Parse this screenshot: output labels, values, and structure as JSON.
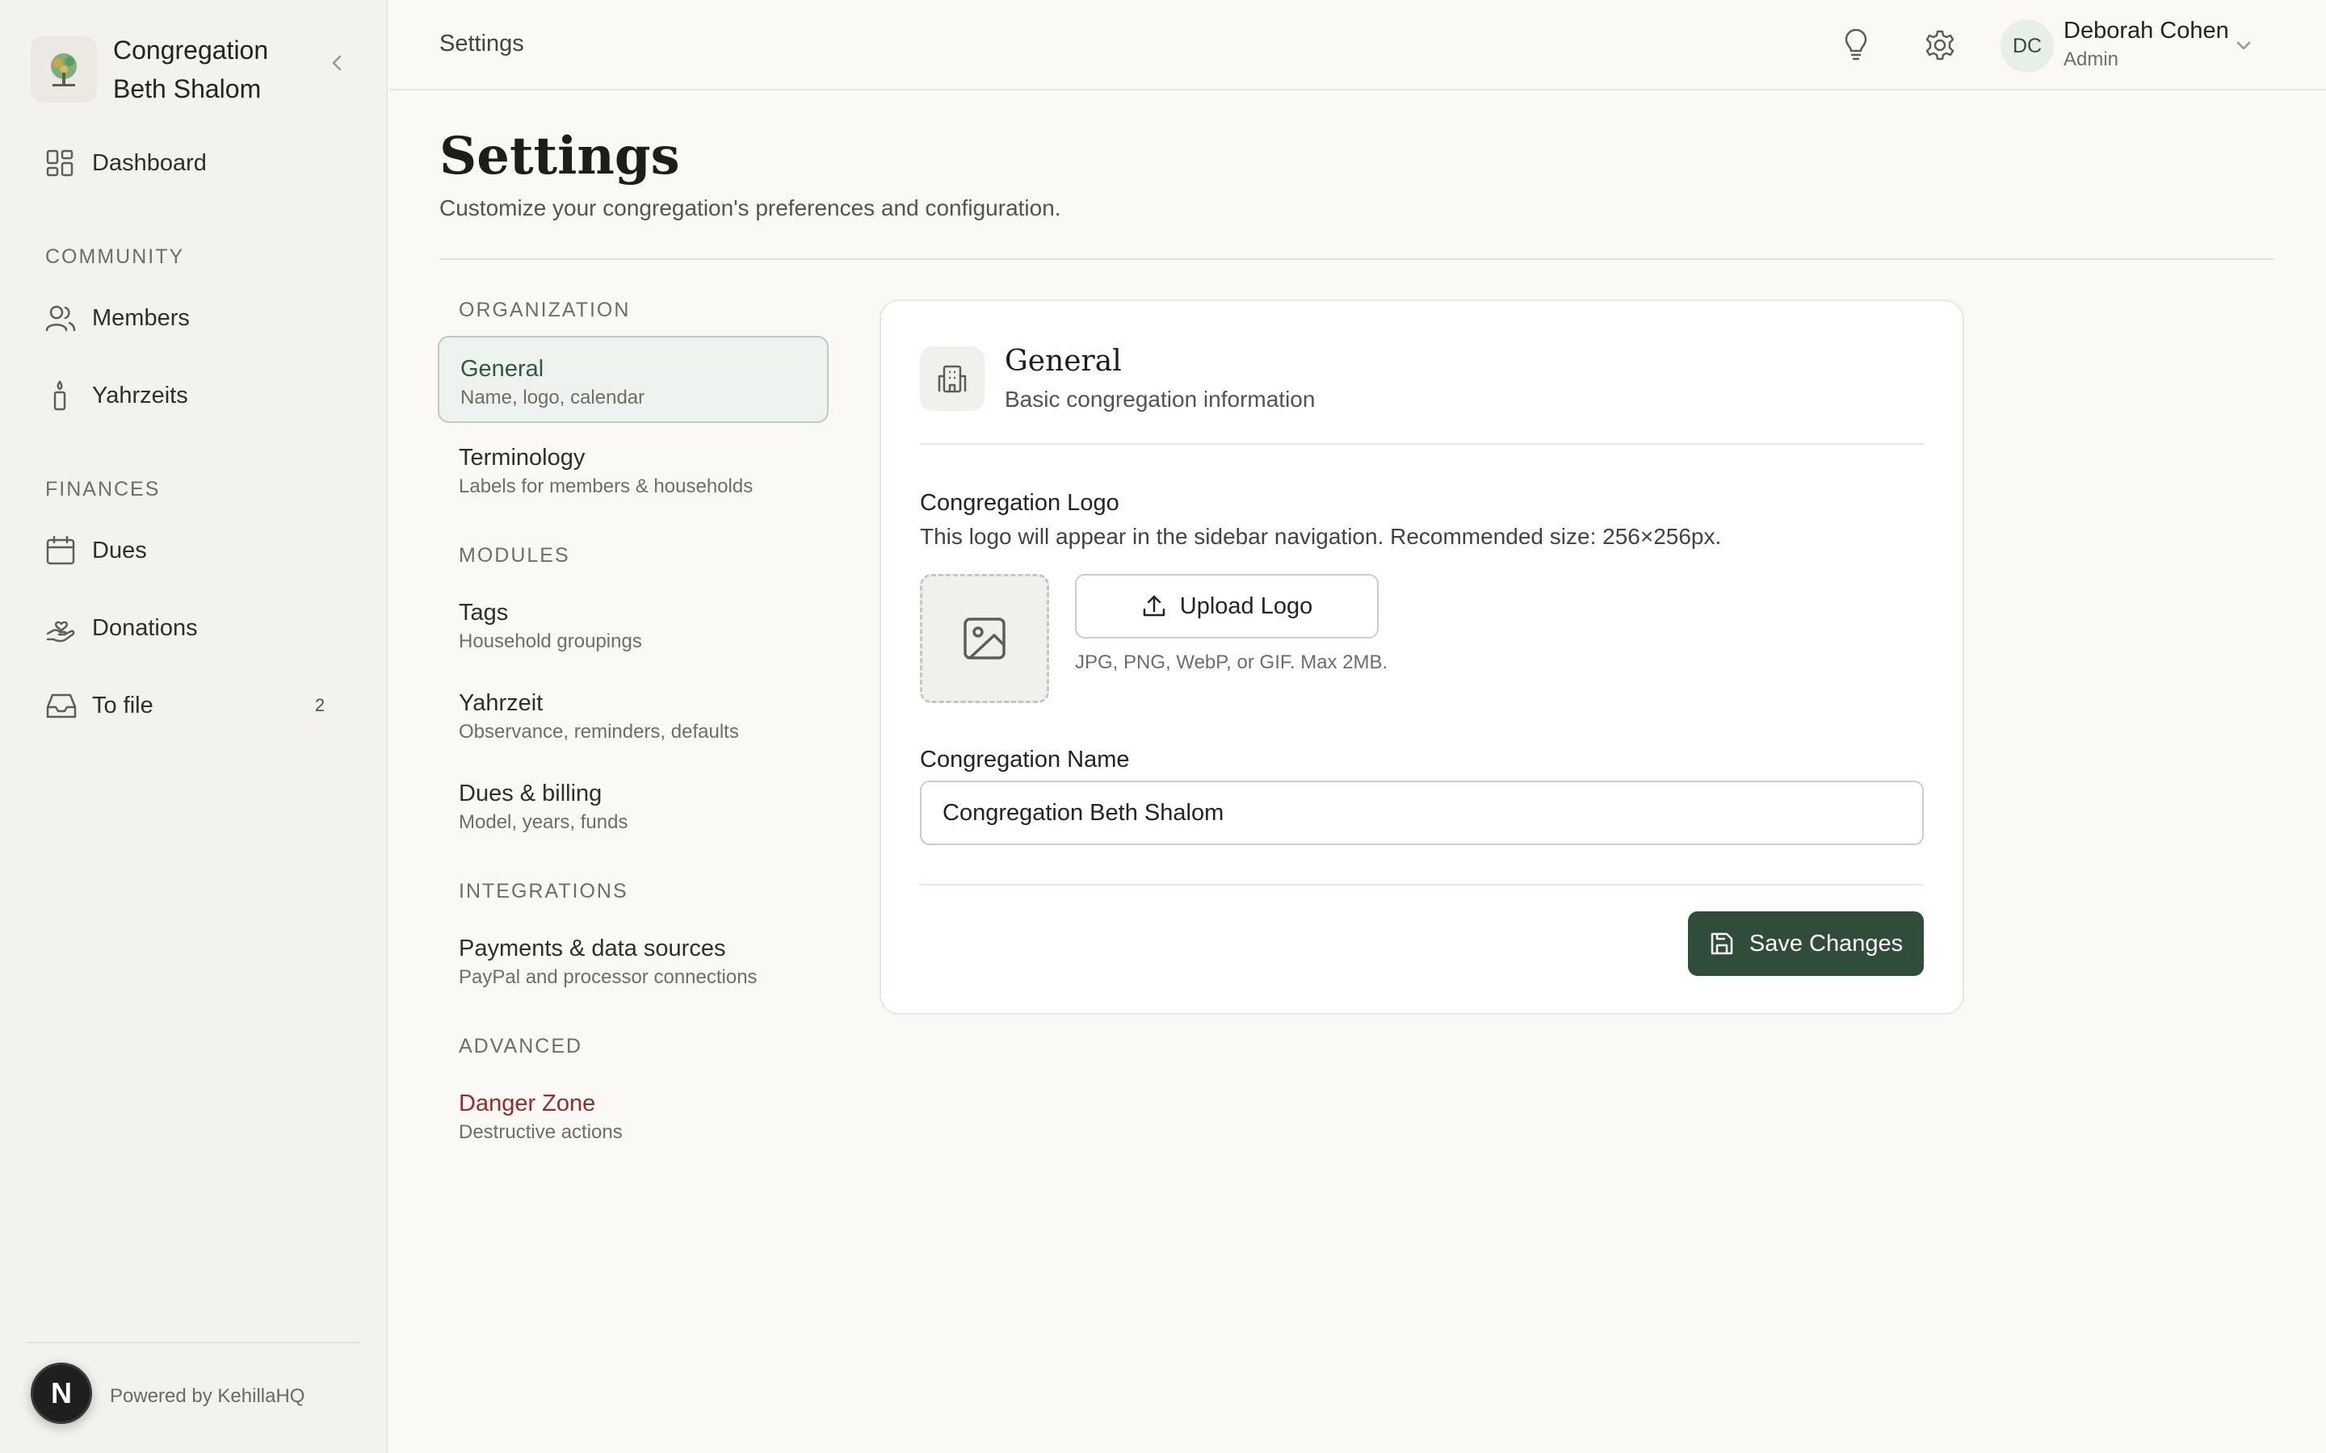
{
  "sidebar": {
    "brand_name": "Congregation Beth Shalom",
    "nav": {
      "dashboard": "Dashboard",
      "community_section": "COMMUNITY",
      "members": "Members",
      "yahrzeits": "Yahrzeits",
      "finances_section": "FINANCES",
      "dues": "Dues",
      "donations": "Donations",
      "to_file": "To file",
      "to_file_count": "2"
    },
    "powered_by": "Powered by KehillaHQ",
    "dev_badge": "N"
  },
  "topbar": {
    "title": "Settings",
    "user": {
      "initials": "DC",
      "name": "Deborah Cohen",
      "role": "Admin"
    }
  },
  "page": {
    "title": "Settings",
    "subtitle": "Customize your congregation's preferences and configuration."
  },
  "settings_nav": {
    "organization": "ORGANIZATION",
    "modules": "MODULES",
    "integrations": "INTEGRATIONS",
    "advanced": "ADVANCED",
    "items": [
      {
        "label": "General",
        "desc": "Name, logo, calendar"
      },
      {
        "label": "Terminology",
        "desc": "Labels for members & households"
      },
      {
        "label": "Tags",
        "desc": "Household groupings"
      },
      {
        "label": "Yahrzeit",
        "desc": "Observance, reminders, defaults"
      },
      {
        "label": "Dues & billing",
        "desc": "Model, years, funds"
      },
      {
        "label": "Payments & data sources",
        "desc": "PayPal and processor connections"
      },
      {
        "label": "Danger Zone",
        "desc": "Destructive actions"
      }
    ]
  },
  "general_card": {
    "title": "General",
    "subtitle": "Basic congregation information",
    "logo_label": "Congregation Logo",
    "logo_help": "This logo will appear in the sidebar navigation. Recommended size: 256×256px.",
    "upload_label": "Upload Logo",
    "upload_hint": "JPG, PNG, WebP, or GIF. Max 2MB.",
    "name_label": "Congregation Name",
    "name_value": "Congregation Beth Shalom",
    "save_label": "Save Changes"
  },
  "colors": {
    "accent": "#2f4d3a",
    "active_bg": "#eef3ef",
    "danger": "#9b2a24",
    "background": "#faf9f6"
  },
  "icons": {
    "brand": "tree-logo-icon",
    "collapse": "chevron-left-icon",
    "dashboard": "grid-icon",
    "members": "users-icon",
    "yahrzeits": "candle-icon",
    "dues": "calendar-icon",
    "donations": "hand-heart-icon",
    "to_file": "inbox-icon",
    "tip": "lightbulb-icon",
    "settings": "gear-icon",
    "card": "building-icon",
    "logo_placeholder": "image-icon",
    "upload": "upload-icon",
    "save": "save-icon"
  }
}
